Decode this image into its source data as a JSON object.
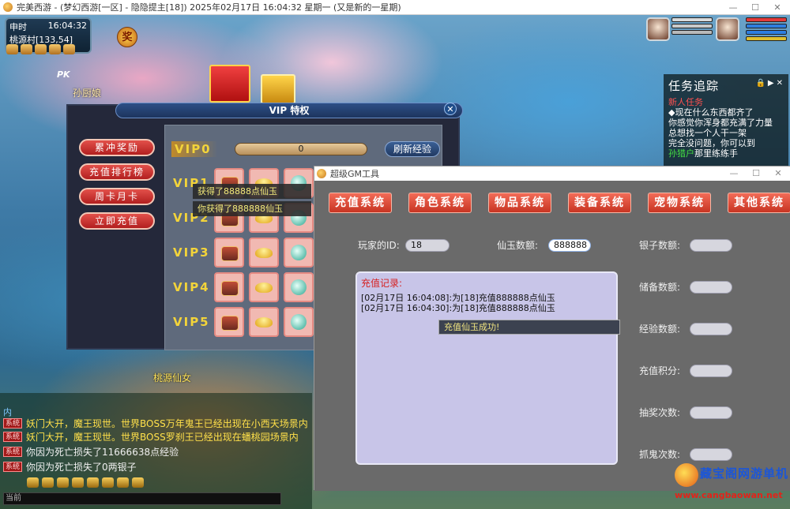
{
  "window": {
    "title": "完美西游 - (梦幻西游[一区] - 隐隐提主[18]) 2025年02月17日 16:04:32 星期一 (又是新的一星期)"
  },
  "hud": {
    "time_label": "申时",
    "time": "16:04:32",
    "location": "桃源村[133,54]",
    "reward_badge": "奖",
    "pk": "PK",
    "npc_name": "孙厨娘",
    "npc_name2": "桃源仙女"
  },
  "quest": {
    "title": "任务追踪",
    "task_name": "新人任务",
    "lines": [
      "◆现在什么东西都齐了",
      "你感觉你浑身都充满了力量",
      "总想找一个人干一架",
      "完全没问题，你可以到"
    ],
    "npc_link": "孙猎户",
    "tail": "那里练练手"
  },
  "vip_panel": {
    "title": "VIP 特权",
    "close": "✕",
    "buttons": [
      "累冲奖励",
      "充值排行榜",
      "周卡月卡",
      "立即充值"
    ],
    "vip0_label": "VIP0",
    "vip0_progress": "0",
    "refresh": "刷新经验",
    "rows": [
      "VIP1",
      "VIP2",
      "VIP3",
      "VIP4",
      "VIP5"
    ],
    "toast1": "获得了88888点仙玉",
    "toast2": "你获得了888888仙玉"
  },
  "chat": {
    "channel": "内",
    "tag": "系统",
    "lines": [
      {
        "text": "妖门大开，魔王现世。世界BOSS万年鬼王已经出现在小西天场景内",
        "color": "yellow"
      },
      {
        "text": "妖门大开，魔王现世。世界BOSS罗刹王已经出现在蟠桃园场景内",
        "color": "yellow"
      },
      {
        "text": "你因为死亡损失了11666638点经验",
        "color": "white"
      },
      {
        "text": "你因为死亡损失了0两银子",
        "color": "white"
      }
    ],
    "input_prefix": "当前"
  },
  "gm_tool": {
    "title": "超级GM工具",
    "nav": [
      "充值系统",
      "角色系统",
      "物品系统",
      "装备系统",
      "宠物系统",
      "其他系统"
    ],
    "player_id_label": "玩家的ID:",
    "player_id_value": "18",
    "xianyu_label": "仙玉数额:",
    "xianyu_value": "888888",
    "right_fields": [
      "银子数额:",
      "储备数额:",
      "经验数额:",
      "充值积分:",
      "抽奖次数:",
      "抓鬼次数:"
    ],
    "log_title": "充值记录:",
    "log_entries": [
      "[02月17日 16:04:08]:为[18]充值888888点仙玉",
      "[02月17日 16:04:30]:为[18]充值888888点仙玉"
    ],
    "tooltip": "充值仙玉成功!"
  },
  "watermark": {
    "main": "藏宝阁网游单机",
    "url": "www.cangbaowan.net"
  }
}
